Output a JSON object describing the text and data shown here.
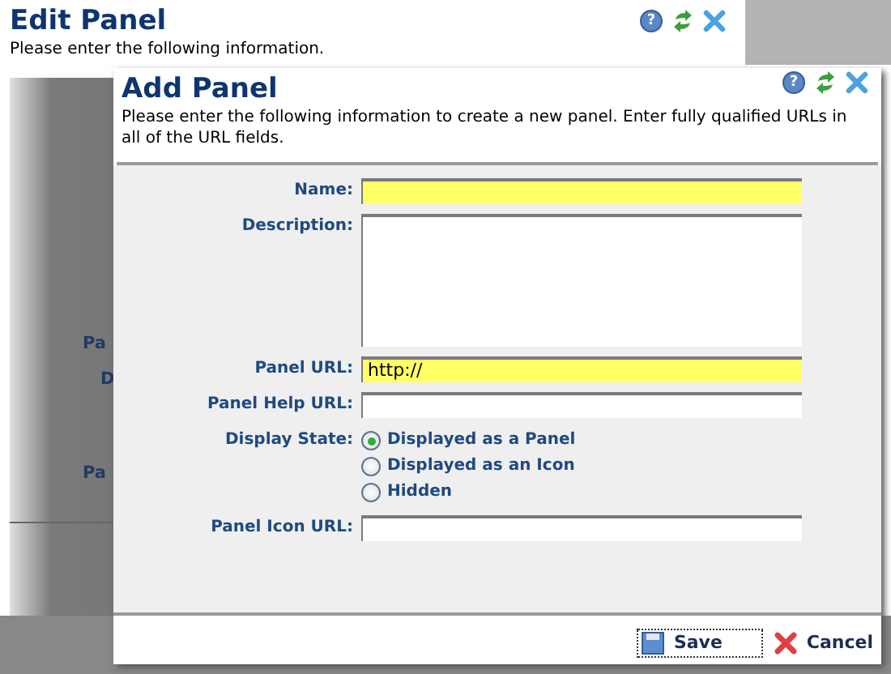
{
  "back_dialog": {
    "title": "Edit Panel",
    "help_glyph": "?",
    "instructions": "Please enter the following information.",
    "labels": [
      "Pa",
      "D",
      "Pa"
    ]
  },
  "dialog": {
    "title": "Add Panel",
    "help_glyph": "?",
    "instructions": "Please enter the following information to create a new panel. Enter fully qualified URLs in all of the URL fields.",
    "fields": [
      {
        "kind": "text",
        "label": "Name:",
        "required": true
      },
      {
        "kind": "textarea",
        "label": "Description:",
        "required": false
      },
      {
        "kind": "text",
        "label": "Panel URL:",
        "value": "http://",
        "required": true
      },
      {
        "kind": "text",
        "label": "Panel Help URL:",
        "required": false
      },
      {
        "kind": "radio",
        "label": "Display State:",
        "options": [
          {
            "label": "Displayed as a Panel",
            "selected": true
          },
          {
            "label": "Displayed as an Icon",
            "selected": false
          },
          {
            "label": "Hidden",
            "selected": false
          }
        ]
      },
      {
        "kind": "text",
        "label": "Panel Icon URL:",
        "required": false
      }
    ],
    "buttons": [
      {
        "kind": "save",
        "label": "Save",
        "focused": true
      },
      {
        "kind": "cancel",
        "label": "Cancel",
        "focused": false
      }
    ]
  }
}
